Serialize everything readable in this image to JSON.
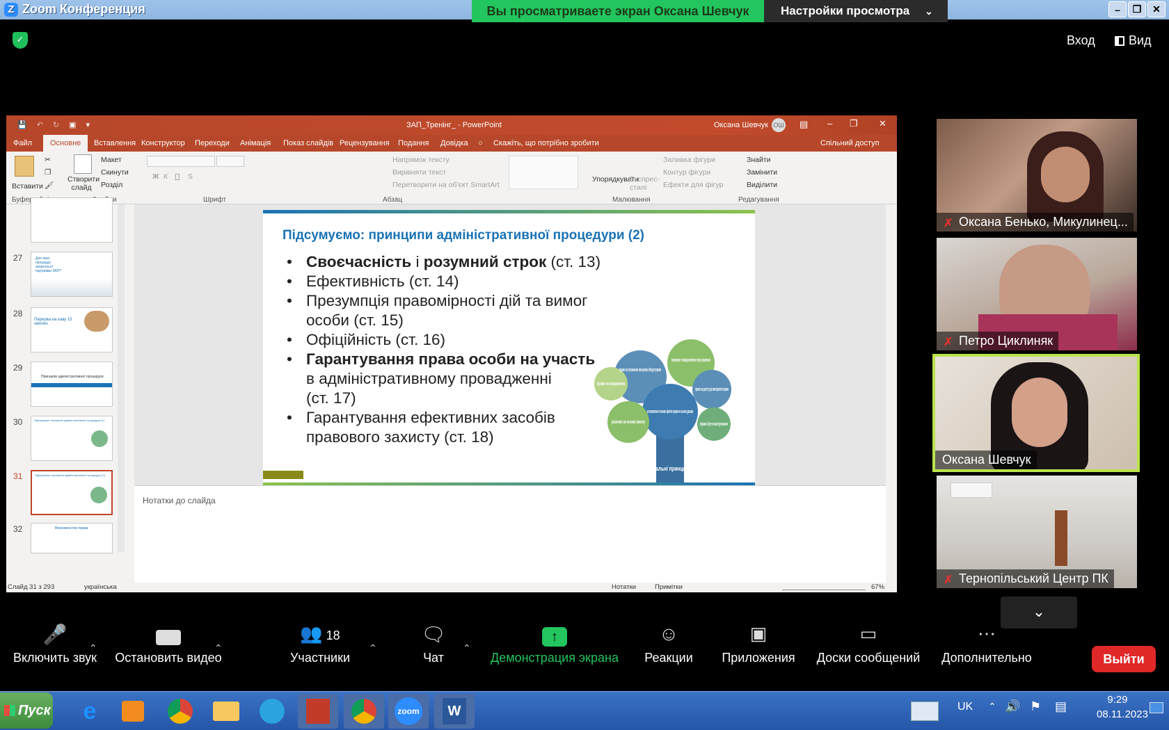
{
  "zoom": {
    "window_title": "Zoom Конференция",
    "share_banner": "Вы просматриваете экран Оксана Шевчук",
    "view_options": "Настройки просмотра",
    "enter_label": "Вход",
    "view_label": "Вид",
    "brand_color": "#23c55e"
  },
  "powerpoint": {
    "doc_title": "ЗАП_Тренінг_ - PowerPoint",
    "user_name": "Оксана Шевчук",
    "user_initials": "ОШ",
    "tabs": [
      "Файл",
      "Основне",
      "Вставлення",
      "Конструктор",
      "Переходи",
      "Анімація",
      "Показ слайдів",
      "Рецензування",
      "Подання",
      "Довідка"
    ],
    "tell_me": "Скажіть, що потрібно зробити",
    "share": "Спільний доступ",
    "ribbon": {
      "paste": "Вставити",
      "clipboard_group": "Буфер обміну",
      "new_slide": "Створити слайд",
      "layout": "Макет",
      "reset": "Скинути",
      "section": "Розділ",
      "slides_group": "Слайди",
      "font_group": "Шрифт",
      "text_direction": "Напрямок тексту",
      "align_text": "Вирівняти текст",
      "smartart": "Перетворити на об'єкт SmartArt",
      "paragraph_group": "Абзац",
      "arrange": "Упорядкувати",
      "quick_styles": "Експрес-стилі",
      "shape_fill": "Заливка фігури",
      "shape_outline": "Контур фігури",
      "shape_effects": "Ефекти для фігур",
      "drawing_group": "Малювання",
      "find": "Знайти",
      "replace": "Замінити",
      "select": "Виділити",
      "editing_group": "Редагування"
    },
    "thumbnails": [
      {
        "num": "27",
        "text": "Для яких процедур зворотньої підтримки ЗАП?"
      },
      {
        "num": "28",
        "text": "Перерва на каву 15 хвилин"
      },
      {
        "num": "29",
        "text": "Принципи адміністративної процедури"
      },
      {
        "num": "30",
        "text": "Підсумуємо: принципи адміністративної процедури (1)"
      },
      {
        "num": "31",
        "text": "Підсумуємо: принципи адміністративної процедури (2)"
      },
      {
        "num": "32",
        "text": "Верховенство права"
      }
    ],
    "notes_placeholder": "Нотатки до слайда",
    "status": {
      "slide_count": "Слайд 31 з 293",
      "language": "українська",
      "notes": "Нотатки",
      "comments": "Примітки",
      "zoom": "67%"
    }
  },
  "slide": {
    "title": "Підсумуємо: принципи адміністративної процедури  (2)",
    "bullets": [
      {
        "bold": "Своєчасність",
        "rest1": " і ",
        "bold2": "розумний строк",
        "rest2": " (ст. 13)"
      },
      {
        "text": "Ефективність (ст. 14)"
      },
      {
        "line1": "Презумпція правомірності дій та вимог",
        "line2": "особи (ст. 15)"
      },
      {
        "text": "Офіційність (ст. 16)"
      },
      {
        "bold": "Гарантування права особи на участь",
        "line2": "в адміністративному провадженні",
        "line3": "(ст. 17)"
      },
      {
        "line1": "Гарантування ефективних засобів",
        "line2": "правового захисту (ст. 18)"
      }
    ],
    "tree": {
      "trunk_label": "загальні принципи",
      "circles": [
        "право на отримання письмово обгрунтуваня",
        "належне повідомлення про рішення",
        "право на оскарження",
        "право на доступ до матеріалів справи",
        "встановлення істинних фактів справи на основі доказів",
        "рішення на основі закону",
        "право бути вислуханим"
      ]
    }
  },
  "participants": [
    {
      "name": "Оксана Бенько, Микулинец...",
      "muted": true
    },
    {
      "name": "Петро Циклиняк",
      "muted": true
    },
    {
      "name": "Оксана Шевчук",
      "muted": false,
      "active_speaker": true
    },
    {
      "name": "Тернопільський Центр ПК",
      "muted": true
    }
  ],
  "toolbar": {
    "audio": "Включить звук",
    "video": "Остановить видео",
    "participants": "Участники",
    "participants_count": "18",
    "chat": "Чат",
    "share": "Демонстрация экрана",
    "reactions": "Реакции",
    "apps": "Приложения",
    "whiteboards": "Доски сообщений",
    "more": "Дополнительно",
    "leave": "Выйти"
  },
  "taskbar": {
    "start": "Пуск",
    "lang": "UK",
    "time": "9:29",
    "date": "08.11.2023"
  }
}
